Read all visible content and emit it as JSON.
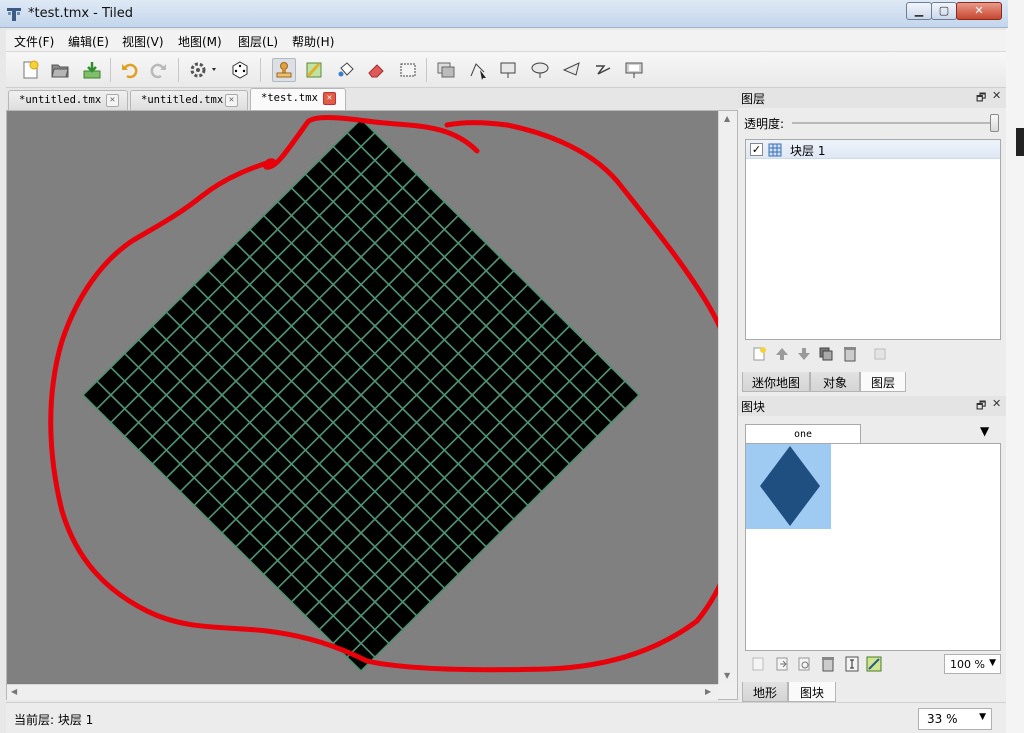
{
  "window": {
    "title": "*test.tmx - Tiled"
  },
  "menu": [
    "文件(F)",
    "编辑(E)",
    "视图(V)",
    "地图(M)",
    "图层(L)",
    "帮助(H)"
  ],
  "toolbar": {
    "tools": [
      "new-file-icon",
      "open-file-icon",
      "save-file-icon",
      "undo-icon",
      "redo-icon",
      "commands-gear-icon",
      "random-dice-icon",
      "stamp-brush-icon",
      "terrain-brush-icon",
      "bucket-fill-icon",
      "eraser-icon",
      "rect-select-icon",
      "object-select-icon",
      "edit-polygon-icon",
      "insert-rectangle-icon",
      "insert-ellipse-icon",
      "insert-polygon-icon",
      "insert-polyline-icon",
      "insert-tile-icon"
    ]
  },
  "tabs": [
    {
      "label": "*untitled.tmx",
      "active": false
    },
    {
      "label": "*untitled.tmx",
      "active": false
    },
    {
      "label": "*test.tmx",
      "active": true
    }
  ],
  "layers_panel": {
    "title": "图层",
    "opacity_label": "透明度:",
    "opacity_value": 1.0,
    "layers": [
      {
        "name": "块层 1",
        "visible": true
      }
    ],
    "tabs": [
      "迷你地图",
      "对象",
      "图层"
    ],
    "active_tab": "图层"
  },
  "tileset_panel": {
    "title": "图块",
    "tileset_tab": "one",
    "zoom": "100 %",
    "tabs": [
      "地形",
      "图块"
    ],
    "active_tab": "图块"
  },
  "status": {
    "current_layer": "当前层: 块层 1",
    "zoom": "33 %"
  },
  "map": {
    "orientation": "isometric",
    "tiles_wide": 20,
    "tiles_high": 20
  },
  "colors": {
    "canvas_bg": "#808080",
    "grid": "#4f8f72",
    "tile": "#000000",
    "annotation": "#e8000b",
    "tile_preview": "#1f4e80"
  }
}
